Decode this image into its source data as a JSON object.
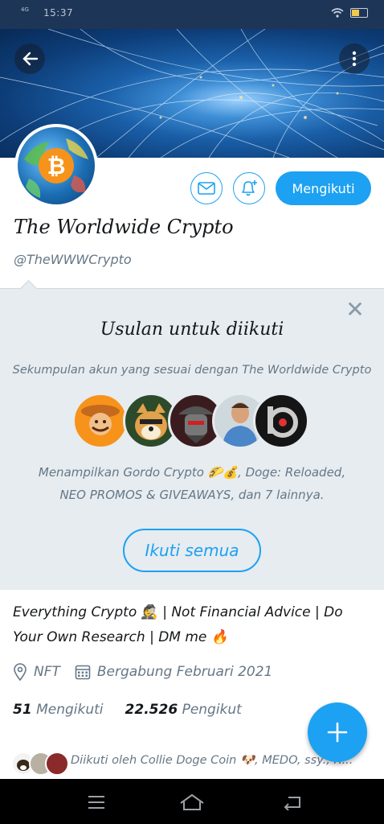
{
  "status_bar": {
    "time": "15:37",
    "network": "4G",
    "icons": [
      "wifi-icon",
      "battery-icon"
    ]
  },
  "header": {
    "back_icon": "arrow-left-icon",
    "more_icon": "more-vertical-icon"
  },
  "profile": {
    "name": "The Worldwide Crypto",
    "handle": "@TheWWWCrypto",
    "follow_button_label": "Mengikuti",
    "bio": "Everything Crypto 🕵️ | Not Financial Advice | Do Your Own Research | DM me 🔥",
    "location": "NFT",
    "joined": "Bergabung Februari 2021",
    "following_count": "51",
    "following_label": "Mengikuti",
    "followers_count": "22.526",
    "followers_label": "Pengikut",
    "followed_by": "Diikuti oleh Collie Doge Coin 🐶, MEDO, ssy., R... lainnya"
  },
  "suggestions": {
    "title": "Usulan untuk diikuti",
    "subtitle": "Sekumpulan akun yang sesuai dengan The Worldwide Crypto",
    "description": "Menampilkan Gordo Crypto 🌮💰, Doge: Reloaded, NEO PROMOS & GIVEAWAYS, dan 7 lainnya.",
    "follow_all_label": "Ikuti semua",
    "avatars": [
      "gordo-crypto",
      "doge-reloaded",
      "neo-promos",
      "person",
      "b-logo"
    ]
  },
  "colors": {
    "accent": "#1da1f2",
    "panel": "#e6ecf0",
    "muted": "#657786"
  }
}
